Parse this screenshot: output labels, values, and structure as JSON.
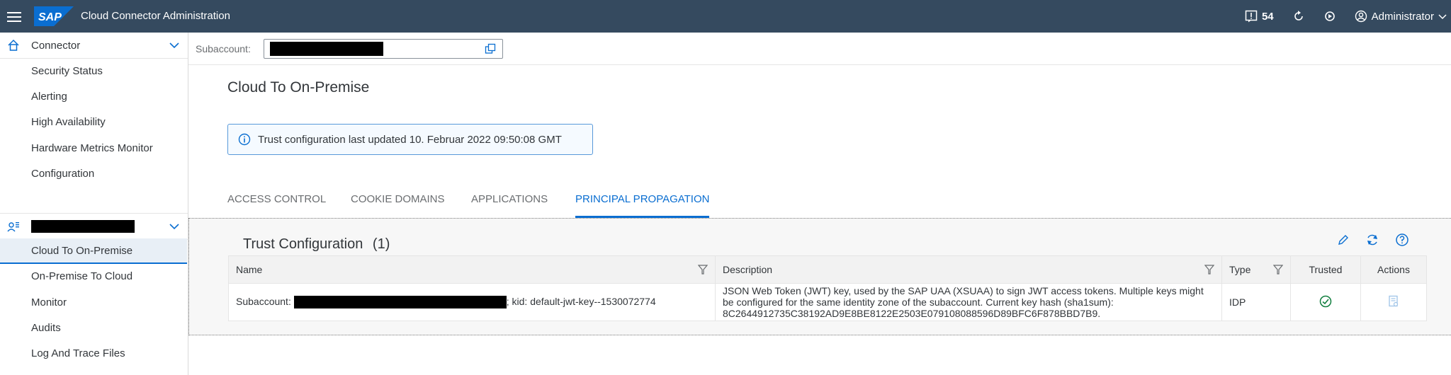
{
  "shell": {
    "title": "Cloud Connector Administration",
    "logo_text": "SAP",
    "notification_count": "54",
    "user": "Administrator",
    "colors": {
      "bar": "#354a5f",
      "logo": "#0a6ed1"
    }
  },
  "sidebar": {
    "connector": {
      "label": "Connector",
      "items": [
        "Security Status",
        "Alerting",
        "High Availability",
        "Hardware Metrics Monitor",
        "Configuration"
      ]
    },
    "subaccount_group": {
      "items": [
        "Cloud To On-Premise",
        "On-Premise To Cloud",
        "Monitor",
        "Audits",
        "Log And Trace Files"
      ],
      "selected_index": 0
    }
  },
  "subaccount": {
    "label": "Subaccount:"
  },
  "page": {
    "title": "Cloud To On-Premise",
    "message": "Trust configuration last updated 10. Februar 2022 09:50:08 GMT"
  },
  "tabs": [
    {
      "label": "ACCESS CONTROL"
    },
    {
      "label": "COOKIE DOMAINS"
    },
    {
      "label": "APPLICATIONS"
    },
    {
      "label": "PRINCIPAL PROPAGATION"
    }
  ],
  "active_tab": 3,
  "trust": {
    "title": "Trust Configuration",
    "count": "(1)",
    "columns": [
      "Name",
      "Description",
      "Type",
      "Trusted",
      "Actions"
    ],
    "row": {
      "name_prefix": "Subaccount:",
      "name_suffix": "; kid: default-jwt-key--1530072774",
      "description": "JSON Web Token (JWT) key, used by the SAP UAA (XSUAA) to sign JWT access tokens. Multiple keys might be configured for the same identity zone of the subaccount. Current key hash (sha1sum): 8C2644912735C38192AD9E8BE8122E2503E079108088596D89BFC6F878BBD7B9.",
      "type": "IDP"
    }
  }
}
